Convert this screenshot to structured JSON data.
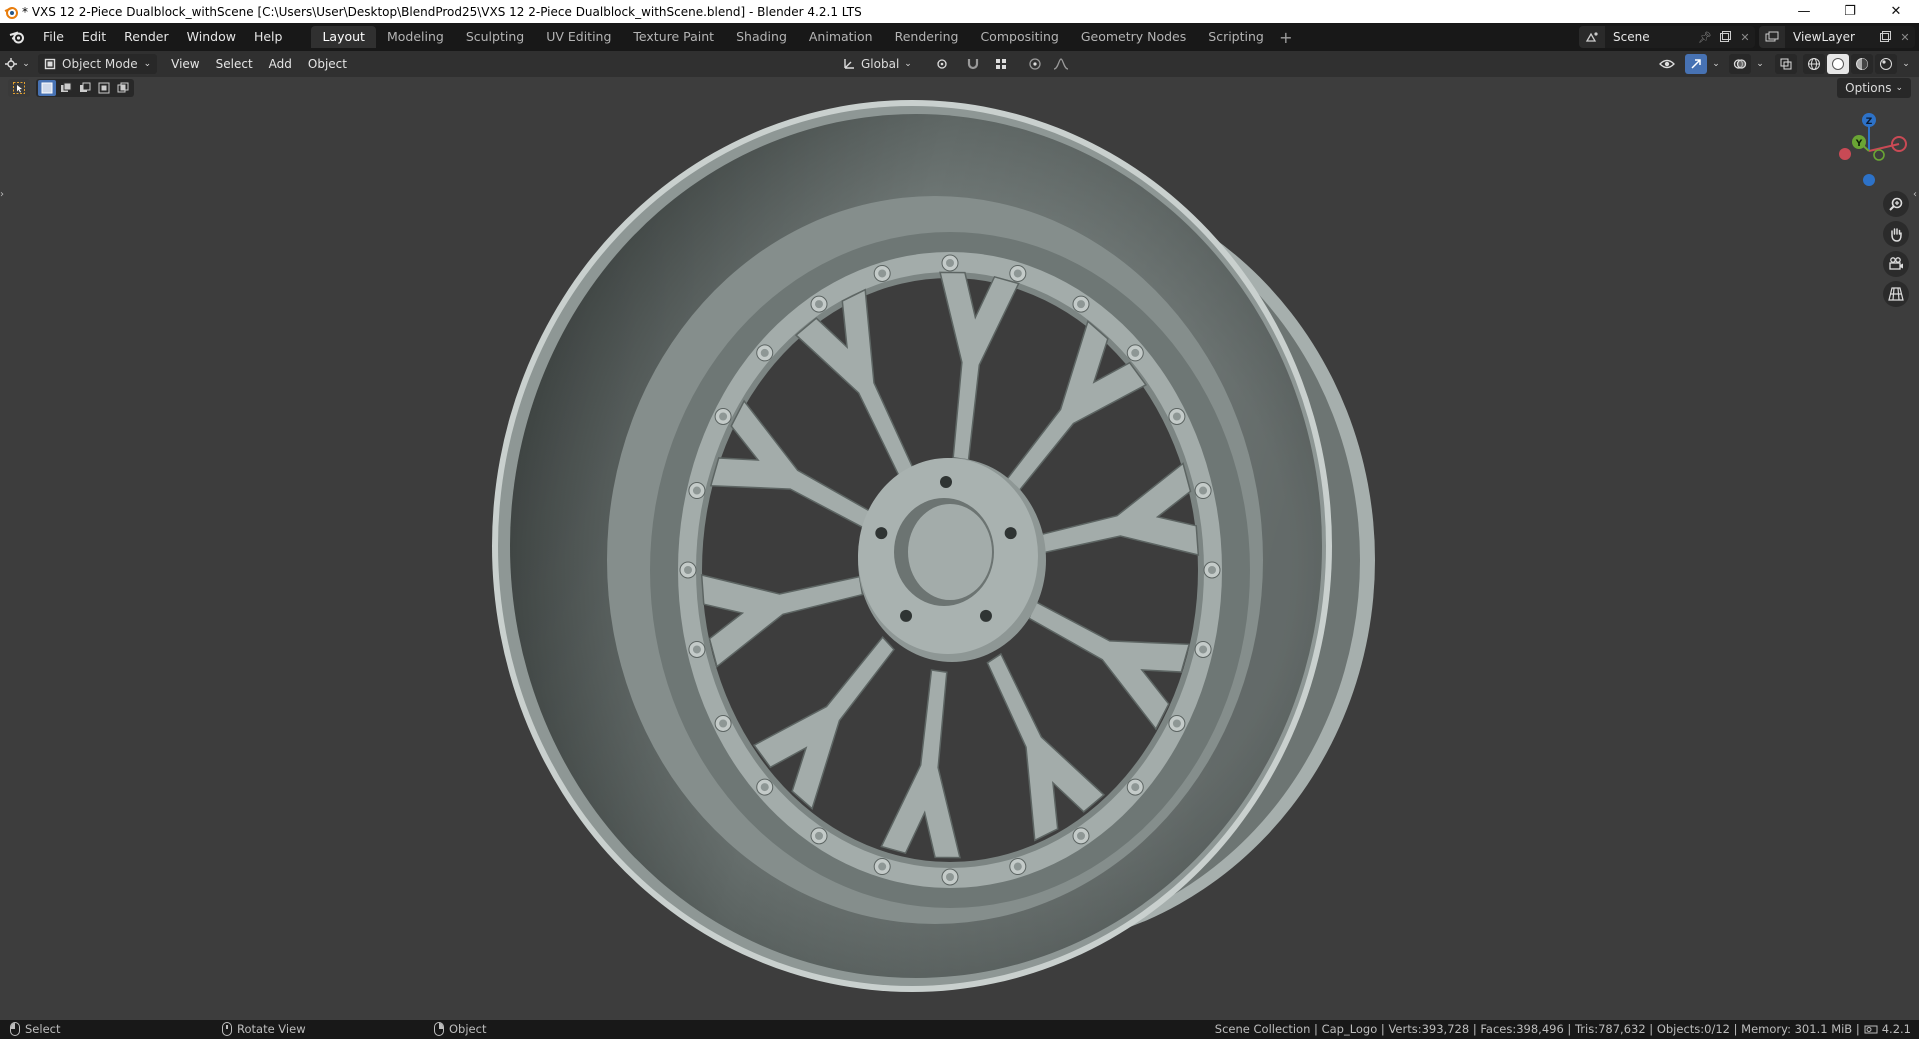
{
  "window": {
    "title": "* VXS 12 2-Piece Dualblock_withScene [C:\\Users\\User\\Desktop\\BlendProd25\\VXS 12 2-Piece Dualblock_withScene.blend] - Blender 4.2.1 LTS",
    "minimize": "—",
    "restore": "❐",
    "close": "✕"
  },
  "menu": [
    "File",
    "Edit",
    "Render",
    "Window",
    "Help"
  ],
  "workspaces": [
    "Layout",
    "Modeling",
    "Sculpting",
    "UV Editing",
    "Texture Paint",
    "Shading",
    "Animation",
    "Rendering",
    "Compositing",
    "Geometry Nodes",
    "Scripting"
  ],
  "workspace_add": "+",
  "scene": {
    "label": "Scene"
  },
  "view_layer": {
    "label": "ViewLayer"
  },
  "viewport_header": {
    "mode": "Object Mode",
    "menus": [
      "View",
      "Select",
      "Add",
      "Object"
    ],
    "orientation": "Global"
  },
  "options": "Options",
  "gizmo": {
    "z": "Z",
    "y": "Y"
  },
  "status": {
    "select": "Select",
    "rotate": "Rotate View",
    "object": "Object",
    "stats": "Scene Collection | Cap_Logo | Verts:393,728 | Faces:398,496 | Tris:787,632 | Objects:0/12 | Memory: 301.1 MiB |",
    "version": "4.2.1"
  },
  "colors": {
    "accent_active": "#4772b3",
    "viewport_bg": "#3d3d3d",
    "model": "#a3acaa"
  }
}
